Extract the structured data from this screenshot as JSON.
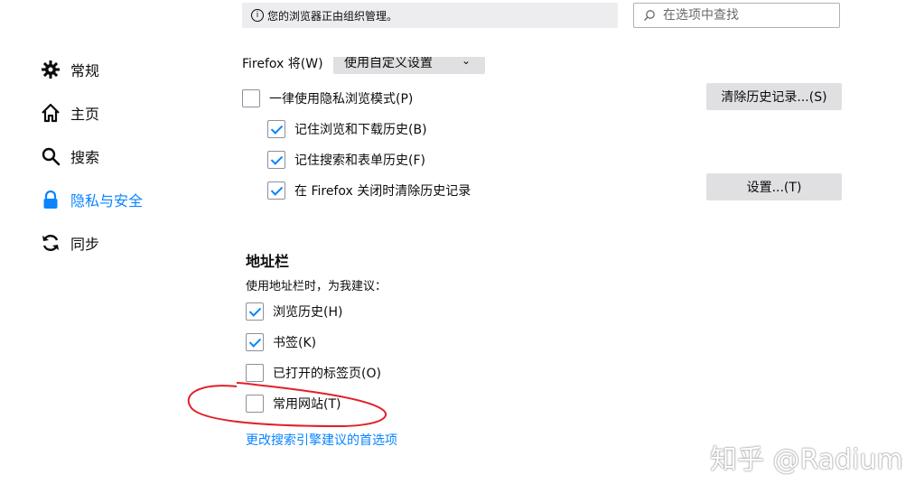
{
  "sidebar": {
    "items": [
      {
        "label": "常规",
        "icon": "gear-icon"
      },
      {
        "label": "主页",
        "icon": "home-icon"
      },
      {
        "label": "搜索",
        "icon": "search-icon"
      },
      {
        "label": "隐私与安全",
        "icon": "lock-icon",
        "active": true
      },
      {
        "label": "同步",
        "icon": "sync-icon"
      }
    ]
  },
  "header": {
    "managed_notice": "您的浏览器正由组织管理。",
    "search_placeholder": "在选项中查找"
  },
  "history": {
    "firefox_will_label": "Firefox 将(W)",
    "mode_value": "使用自定义设置",
    "private_mode": {
      "label": "一律使用隐私浏览模式(P)",
      "checked": false
    },
    "remember_browsing": {
      "label": "记住浏览和下载历史(B)",
      "checked": true
    },
    "remember_search": {
      "label": "记住搜索和表单历史(F)",
      "checked": true
    },
    "clear_on_close": {
      "label": "在 Firefox 关闭时清除历史记录",
      "checked": true
    },
    "clear_history_button": "清除历史记录...(S)",
    "settings_button": "设置...(T)"
  },
  "address_bar": {
    "heading": "地址栏",
    "description": "使用地址栏时，为我建议：",
    "options": [
      {
        "label": "浏览历史(H)",
        "checked": true
      },
      {
        "label": "书签(K)",
        "checked": true
      },
      {
        "label": "已打开的标签页(O)",
        "checked": false
      },
      {
        "label": "常用网站(T)",
        "checked": false
      }
    ],
    "change_link": "更改搜索引擎建议的首选项"
  },
  "watermark": "知乎 @Radium",
  "colors": {
    "accent": "#0a84ff",
    "annotation": "#e0202a",
    "button_bg": "#e0e0e2"
  }
}
